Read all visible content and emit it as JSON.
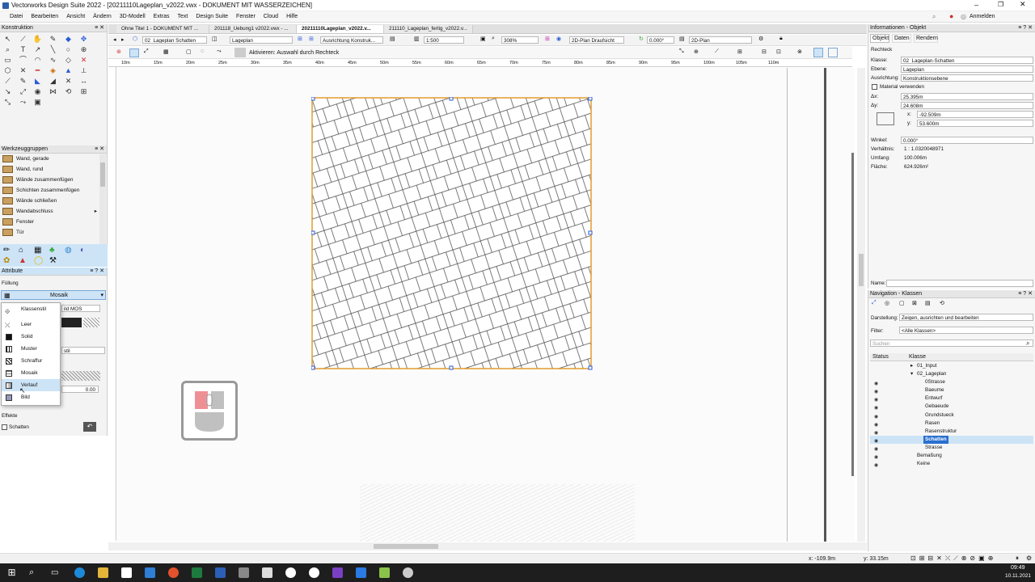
{
  "window_title": "Vectorworks Design Suite 2022 - [20211110Lageplan_v2022.vwx - DOKUMENT MIT WASSERZEICHEN]",
  "menu": [
    "Datei",
    "Bearbeiten",
    "Ansicht",
    "Ändern",
    "3D-Modell",
    "Extras",
    "Text",
    "Design Suite",
    "Fenster",
    "Cloud",
    "Hilfe"
  ],
  "anmelden": "Anmelden",
  "tabs": [
    "Ohne Titel 1 - DOKUMENT MIT ...",
    "201118_Uebung1 v2022.vwx - ...",
    "20211110Lageplan_v2022.v...",
    "211110_Lageplan_fertig_v2022.v..."
  ],
  "toolbar": {
    "class": "02_Lageplan Schatten",
    "layer": "Lageplan",
    "align": "Ausrichtung Konstruk...",
    "scale": "1:500",
    "zoom": "308%",
    "view": "2D-Plan Draufsicht",
    "angle": "0.000°",
    "plan": "2D-Plan"
  },
  "mode_hint": "Aktivieren: Auswahl durch Rechteck",
  "panels": {
    "konstruktion": "Konstruktion",
    "werkzeuggruppen": "Werkzeuggruppen",
    "attribute": "Attribute",
    "info": "Informationen - Objekt",
    "nav": "Navigation - Klassen"
  },
  "tool_groups": [
    "Wand, gerade",
    "Wand, rund",
    "Wände zusammenfügen",
    "Schichten zusammenfügen",
    "Wände schließen",
    "Wandabschluss",
    "Fenster",
    "Tür"
  ],
  "attr": {
    "fuellung": "Füllung",
    "fill_type": "Mosaik",
    "effekte": "Effekte",
    "schatten": "Schatten",
    "frag1": "ild MOS",
    "frag2": "stil",
    "value": "0.00"
  },
  "fill_menu": [
    "Klassenstil",
    "Leer",
    "Solid",
    "Muster",
    "Schraffur",
    "Mosaik",
    "Verlauf",
    "Bild"
  ],
  "info": {
    "tabs": [
      "Objekt",
      "Daten",
      "Rendern"
    ],
    "type": "Rechteck",
    "klasse_label": "Klasse:",
    "klasse": "02_Lageplan-Schatten",
    "ebene_label": "Ebene:",
    "ebene": "Lageplan",
    "ausr_label": "Ausrichtung:",
    "ausr": "Konstruktionsebene",
    "material": "Material verwenden",
    "dx_label": "Δx:",
    "dx": "25.395m",
    "dy_label": "Δy:",
    "dy": "24.608m",
    "x_label": "x:",
    "x": "-92.509m",
    "y_label": "y:",
    "y": "53.600m",
    "winkel_label": "Winkel:",
    "winkel": "0.000°",
    "verh_label": "Verhältnis:",
    "verh": "1 : 1.0320048971",
    "umfang_label": "Umfang:",
    "umfang": "100.006m",
    "flaeche_label": "Fläche:",
    "flaeche": "624.926m²",
    "name_label": "Name:"
  },
  "nav": {
    "darst_label": "Darstellung:",
    "darst": "Zeigen, ausrichten und bearbeiten",
    "filter_label": "Filter:",
    "filter": "<Alle Klassen>",
    "search": "Suchen",
    "col_status": "Status",
    "col_klasse": "Klasse",
    "classes": [
      "01_Input",
      "02_Lageplan",
      "0Strasse",
      "Baeume",
      "Entwurf",
      "Gebaeude",
      "Grundstueck",
      "Rasen",
      "Rasenstruktur",
      "Schatten",
      "Strasse",
      "Bemaßung",
      "Keine"
    ]
  },
  "status": {
    "x": "x: -109.9m",
    "y": "y: 33.15m"
  },
  "ruler": [
    "10m",
    "15m",
    "20m",
    "25m",
    "30m",
    "35m",
    "40m",
    "45m",
    "50m",
    "55m",
    "60m",
    "65m",
    "70m",
    "75m",
    "80m",
    "85m",
    "90m",
    "95m",
    "100m",
    "105m",
    "110m"
  ],
  "clock": {
    "time": "09:49",
    "date": "10.11.2021"
  }
}
